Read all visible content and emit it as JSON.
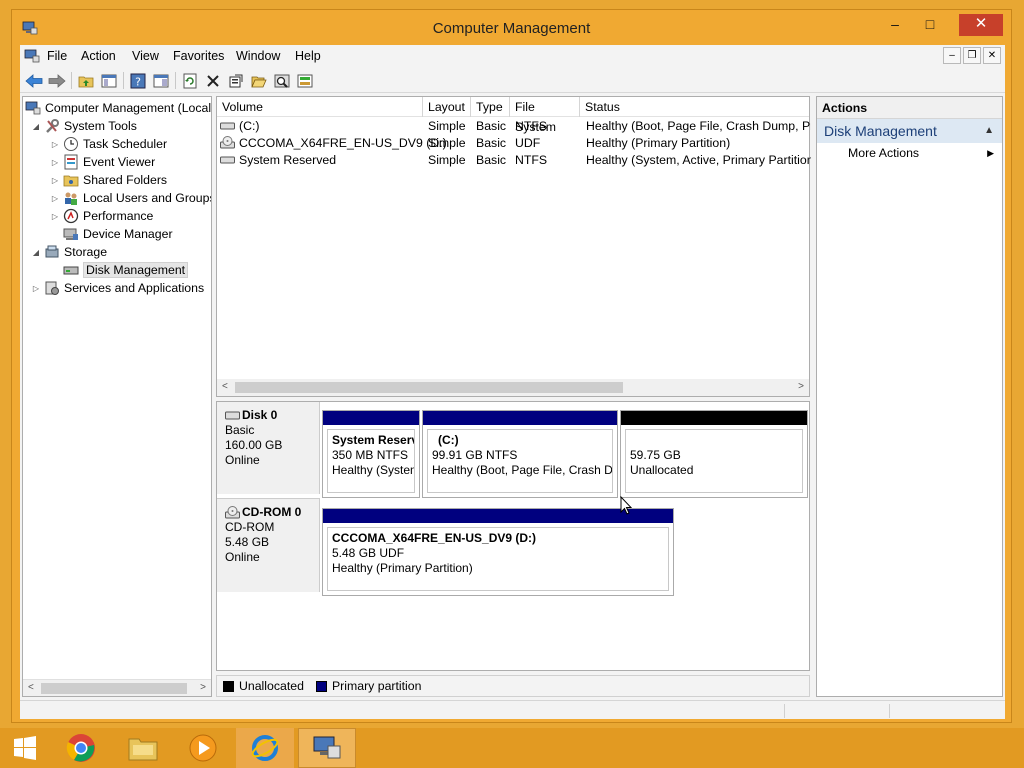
{
  "window": {
    "title": "Computer Management",
    "minimize": "–",
    "maximize": "□",
    "close": "✕"
  },
  "menu": [
    "File",
    "Action",
    "View",
    "Favorites",
    "Window",
    "Help"
  ],
  "mdi": {
    "minimize": "–",
    "restore": "❐",
    "close": "✕"
  },
  "tree": {
    "root": "Computer Management (Local",
    "items": [
      {
        "label": "System Tools",
        "level": 1
      },
      {
        "label": "Task Scheduler",
        "level": 2
      },
      {
        "label": "Event Viewer",
        "level": 2
      },
      {
        "label": "Shared Folders",
        "level": 2
      },
      {
        "label": "Local Users and Groups",
        "level": 2
      },
      {
        "label": "Performance",
        "level": 2
      },
      {
        "label": "Device Manager",
        "level": 2
      },
      {
        "label": "Storage",
        "level": 1
      },
      {
        "label": "Disk Management",
        "level": 2
      },
      {
        "label": "Services and Applications",
        "level": 1
      }
    ]
  },
  "volumes": {
    "columns": [
      "Volume",
      "Layout",
      "Type",
      "File System",
      "Status"
    ],
    "rows": [
      {
        "volume": "(C:)",
        "layout": "Simple",
        "type": "Basic",
        "fs": "NTFS",
        "status": "Healthy (Boot, Page File, Crash Dump, Prin"
      },
      {
        "volume": "CCCOMA_X64FRE_EN-US_DV9 (D:)",
        "layout": "Simple",
        "type": "Basic",
        "fs": "UDF",
        "status": "Healthy (Primary Partition)"
      },
      {
        "volume": "System Reserved",
        "layout": "Simple",
        "type": "Basic",
        "fs": "NTFS",
        "status": "Healthy (System, Active, Primary Partition)"
      }
    ]
  },
  "disks": [
    {
      "name": "Disk 0",
      "kind": "Basic",
      "size": "160.00 GB",
      "state": "Online",
      "partitions": [
        {
          "name": "System Reserv",
          "size": "350 MB NTFS",
          "status": "Healthy (System",
          "color": "#00007f"
        },
        {
          "name": "(C:)",
          "size": "99.91 GB NTFS",
          "status": "Healthy (Boot, Page File, Crash Du",
          "color": "#00007f"
        },
        {
          "name": "",
          "size": "59.75 GB",
          "status": "Unallocated",
          "color": "#000000"
        }
      ]
    },
    {
      "name": "CD-ROM 0",
      "kind": "CD-ROM",
      "size": "5.48 GB",
      "state": "Online",
      "partitions": [
        {
          "name": "CCCOMA_X64FRE_EN-US_DV9  (D:)",
          "size": "5.48 GB UDF",
          "status": "Healthy (Primary Partition)",
          "color": "#00007f"
        }
      ]
    }
  ],
  "legend": [
    {
      "label": "Unallocated",
      "color": "#000000"
    },
    {
      "label": "Primary partition",
      "color": "#00007f"
    }
  ],
  "actions": {
    "header": "Actions",
    "section": "Disk Management",
    "items": [
      "More Actions"
    ]
  },
  "colors": {
    "accent": "#f0a932",
    "primary_partition": "#00007f",
    "unallocated": "#000000"
  }
}
